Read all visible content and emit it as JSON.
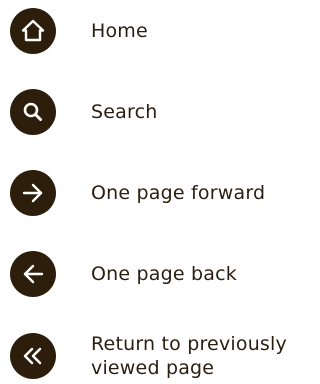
{
  "colors": {
    "icon_background": "#2d1e0c",
    "icon_foreground": "#ffffff",
    "text": "#2a1e10"
  },
  "items": [
    {
      "label": "Home",
      "icon": "home-icon"
    },
    {
      "label": "Search",
      "icon": "search-icon"
    },
    {
      "label": "One page forward",
      "icon": "arrow-right-icon"
    },
    {
      "label": "One page back",
      "icon": "arrow-left-icon"
    },
    {
      "label": "Return to previously viewed page",
      "icon": "double-chevron-left-icon"
    }
  ]
}
